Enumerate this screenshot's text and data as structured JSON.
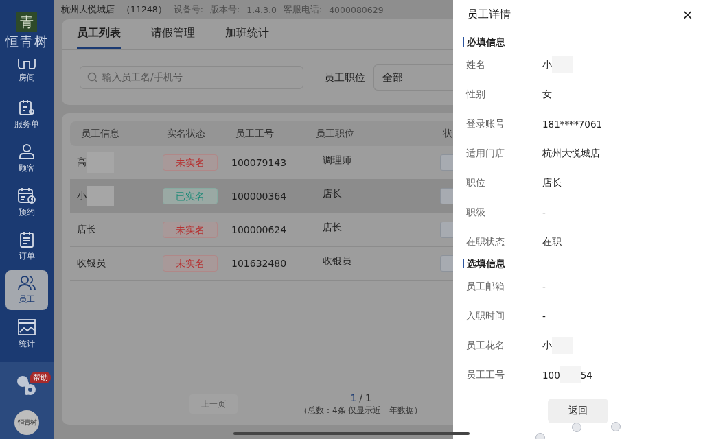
{
  "sidebar": {
    "logo": {
      "mark": "青",
      "name": "恒青树"
    },
    "items": [
      {
        "label": "房间",
        "selected": false
      },
      {
        "label": "服务单",
        "selected": false
      },
      {
        "label": "顾客",
        "selected": false
      },
      {
        "label": "预约",
        "selected": false
      },
      {
        "label": "订单",
        "selected": false
      },
      {
        "label": "员工",
        "selected": true
      },
      {
        "label": "统计",
        "selected": false
      }
    ],
    "help": {
      "badge": "帮助"
    },
    "brand_badge": "恒青树"
  },
  "info_bar": {
    "store": "杭州大悦城店",
    "store_code": "（11248）",
    "device_label": "设备号:",
    "version_label": "版本号:",
    "version": "1.4.3.0",
    "hotline_label": "客服电话:",
    "hotline": "4000080629"
  },
  "tabs": [
    {
      "label": "员工列表",
      "selected": true
    },
    {
      "label": "请假管理",
      "selected": false
    },
    {
      "label": "加班统计",
      "selected": false
    }
  ],
  "filters": {
    "search": {
      "placeholder": "输入员工名/手机号"
    },
    "position_label": "员工职位",
    "position_value": "全部"
  },
  "table": {
    "columns": [
      "员工信息",
      "实名状态",
      "员工工号",
      "员工职位",
      "状"
    ],
    "rows": [
      {
        "name": "高",
        "redacted": true,
        "verified": false,
        "status": "未实名",
        "number": "100079143",
        "position": "调理师",
        "selected": false
      },
      {
        "name": "小",
        "redacted": true,
        "verified": true,
        "status": "已实名",
        "number": "100000364",
        "position": "店长",
        "selected": true
      },
      {
        "name": "店长",
        "redacted": false,
        "verified": false,
        "status": "未实名",
        "number": "100000624",
        "position": "店长",
        "selected": false
      },
      {
        "name": "收银员",
        "redacted": false,
        "verified": false,
        "status": "未实名",
        "number": "101632480",
        "position": "收银员",
        "selected": false
      }
    ]
  },
  "pagination": {
    "prev": {
      "label": "上一页",
      "disabled": true
    },
    "current": "1",
    "separator": "/",
    "total_pages": "1",
    "summary": "（总数：4条 仅显示近一年数据）"
  },
  "drawer": {
    "title": "员工详情",
    "close": "×",
    "sections": [
      {
        "title": "必填信息",
        "fields": [
          {
            "label": "姓名",
            "value": "小",
            "redacted": true
          },
          {
            "label": "性别",
            "value": "女",
            "redacted": false
          },
          {
            "label": "登录账号",
            "value": "181****7061",
            "redacted": false
          },
          {
            "label": "适用门店",
            "value": "杭州大悦城店",
            "redacted": false
          },
          {
            "label": "职位",
            "value": "店长",
            "redacted": false
          },
          {
            "label": "职级",
            "value": "-",
            "redacted": false
          },
          {
            "label": "在职状态",
            "value": "在职",
            "redacted": false
          }
        ]
      },
      {
        "title": "选填信息",
        "fields": [
          {
            "label": "员工邮箱",
            "value": "-",
            "redacted": false
          },
          {
            "label": "入职时间",
            "value": "-",
            "redacted": false
          },
          {
            "label": "员工花名",
            "value": "小",
            "redacted": true
          },
          {
            "label": "员工工号",
            "value": "100",
            "redacted": true,
            "tail": "54"
          }
        ]
      }
    ],
    "back_button": "返回"
  }
}
